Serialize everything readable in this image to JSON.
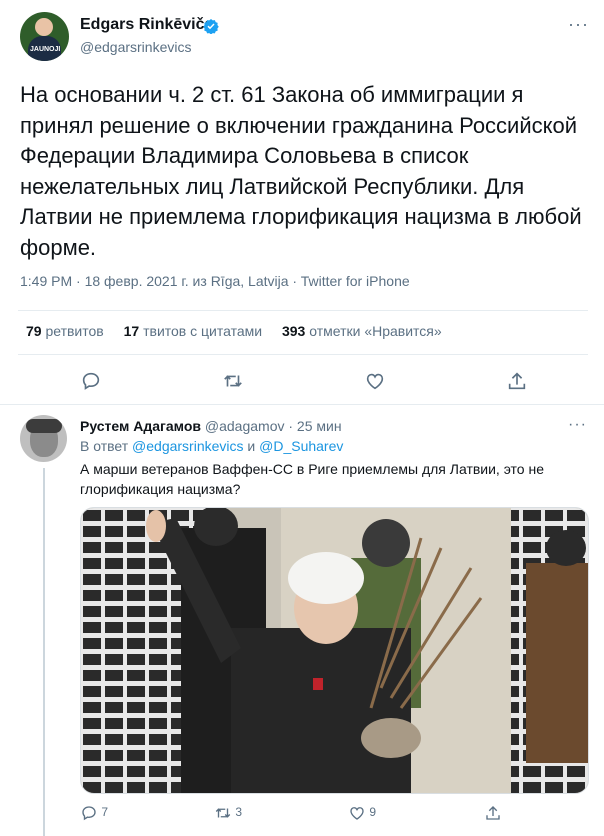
{
  "main_tweet": {
    "author_name": "Edgars Rinkēvičs",
    "author_handle": "@edgarsrinkevics",
    "avatar_label": "JAUNOJI",
    "more_label": "···",
    "text": "На основании ч. 2 ст. 61 Закона об иммиграции я принял решение о включении гражданина Российской Федерации Владимира Соловьева в список нежелательных лиц Латвийской Республики. Для Латвии не приемлема глорификация нацизма в любой форме.",
    "meta": "1:49 PM · 18 февр. 2021 г. из Rīga, Latvija · Twitter for iPhone",
    "stats": [
      {
        "count": "79",
        "label": "ретвитов"
      },
      {
        "count": "17",
        "label": "твитов с цитатами"
      },
      {
        "count": "393",
        "label": "отметки «Нравится»"
      }
    ],
    "actions": [
      "reply-icon",
      "retweet-icon",
      "like-icon",
      "share-icon"
    ]
  },
  "reply_tweet": {
    "author_name": "Рустем Адагамов",
    "author_handle": "@adagamov",
    "time": "· 25 мин",
    "more_label": "···",
    "replying_prefix": "В ответ",
    "replying_user1": "@edgarsrinkevics",
    "replying_and": "и",
    "replying_user2": "@D_Suharev",
    "text": "А марши ветеранов Ваффен-СС в Риге приемлемы для Латвии, это не глорификация нацизма?",
    "reply_count": "7",
    "retweet_count": "3",
    "like_count": "9"
  },
  "colors": {
    "link": "#1b95e0",
    "verified": "#1da1f2",
    "muted": "#5b7083",
    "text": "#0f1419",
    "divider": "#e6ecf0"
  }
}
